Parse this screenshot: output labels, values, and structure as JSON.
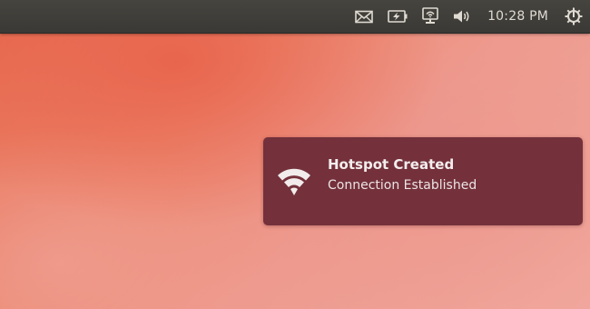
{
  "panel": {
    "indicators": [
      {
        "icon": "mail-icon"
      },
      {
        "icon": "battery-icon"
      },
      {
        "icon": "network-icon"
      },
      {
        "icon": "volume-icon"
      }
    ],
    "clock": "10:28 PM",
    "session_icon": "power-gear-icon"
  },
  "notification": {
    "icon": "wifi-icon",
    "title": "Hotspot Created",
    "body": "Connection Established"
  },
  "colors": {
    "panel": "#3d3c38",
    "notification_bg": "#74313b",
    "desktop_accent": "#e66a4e"
  }
}
